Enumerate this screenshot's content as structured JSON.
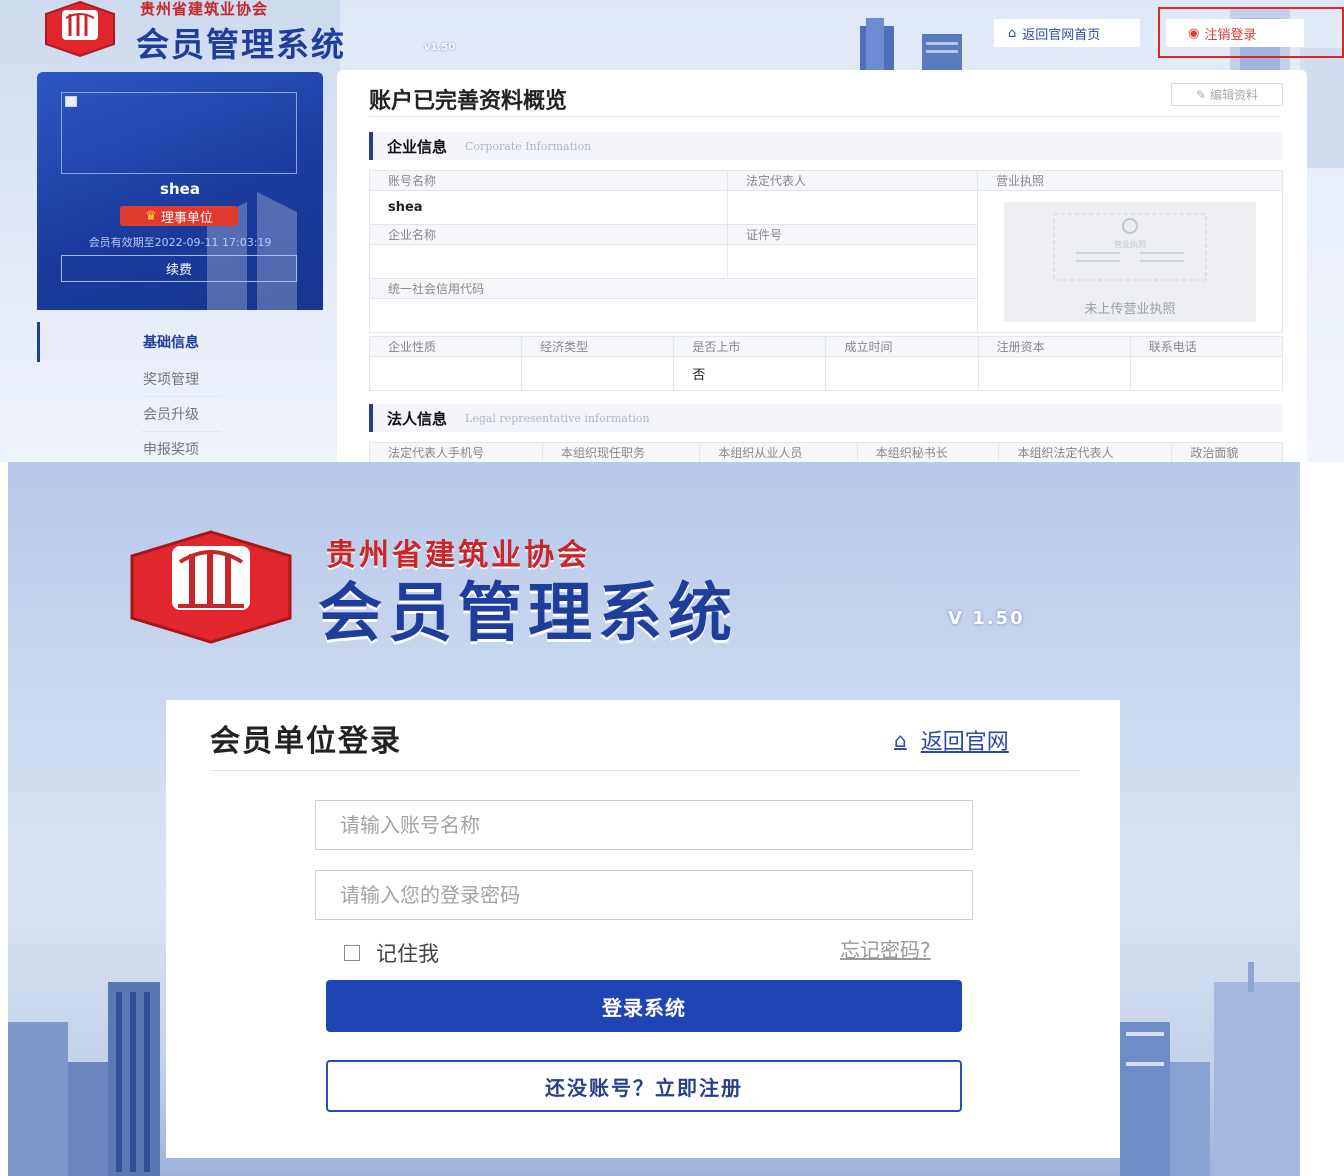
{
  "top": {
    "header": {
      "association_name": "贵州省建筑业协会",
      "system_name": "会员管理系统",
      "version": "v1.50",
      "home_button": "返回官网首页",
      "logout_button": "注销登录"
    },
    "profile": {
      "name": "shea",
      "badge": "理事单位",
      "expiry": "会员有效期至2022-09-11 17:03:19",
      "renew_button": "续费"
    },
    "menu": {
      "items": [
        {
          "label": "基础信息"
        },
        {
          "label": "奖项管理"
        },
        {
          "label": "会员升级"
        },
        {
          "label": "申报奖项"
        }
      ]
    },
    "content": {
      "title": "账户已完善资料概览",
      "edit_button": "编辑资料",
      "corporate": {
        "title_zh": "企业信息",
        "title_en": "Corporate Information",
        "account_name_label": "账号名称",
        "account_name_value": "shea",
        "legal_rep_label": "法定代表人",
        "legal_rep_value": "",
        "license_label": "营业执照",
        "license_placeholder": "营业执照",
        "license_empty": "未上传营业执照",
        "company_name_label": "企业名称",
        "company_name_value": "",
        "id_no_label": "证件号",
        "id_no_value": "",
        "credit_code_label": "统一社会信用代码",
        "credit_code_value": "",
        "nature_label": "企业性质",
        "nature_value": "",
        "econ_type_label": "经济类型",
        "econ_type_value": "",
        "listed_label": "是否上市",
        "listed_value": "否",
        "founded_label": "成立时间",
        "founded_value": "",
        "capital_label": "注册资本",
        "capital_value": "",
        "phone_label": "联系电话",
        "phone_value": ""
      },
      "legal": {
        "title_zh": "法人信息",
        "title_en": "Legal representative information",
        "columns": [
          "法定代表人手机号",
          "本组织现任职务",
          "本组织从业人员",
          "本组织秘书长",
          "本组织法定代表人",
          "政治面貌"
        ]
      }
    }
  },
  "bottom": {
    "association_name": "贵州省建筑业协会",
    "system_name": "会员管理系统",
    "version": "V 1.50",
    "login": {
      "title": "会员单位登录",
      "home_link": "返回官网",
      "account_placeholder": "请输入账号名称",
      "password_placeholder": "请输入您的登录密码",
      "remember_label": "记住我",
      "forgot_link": "忘记密码?",
      "submit_button": "登录系统",
      "register_button": "还没账号？立即注册"
    }
  },
  "colors": {
    "brand_blue": "#1f3d9b",
    "brand_red": "#c8262a",
    "button_blue": "#1f44b4",
    "highlight_red": "#e02424"
  },
  "icons": {
    "home": "house-icon",
    "logout": "power-icon",
    "edit": "edit-icon",
    "crown": "crown-icon"
  }
}
